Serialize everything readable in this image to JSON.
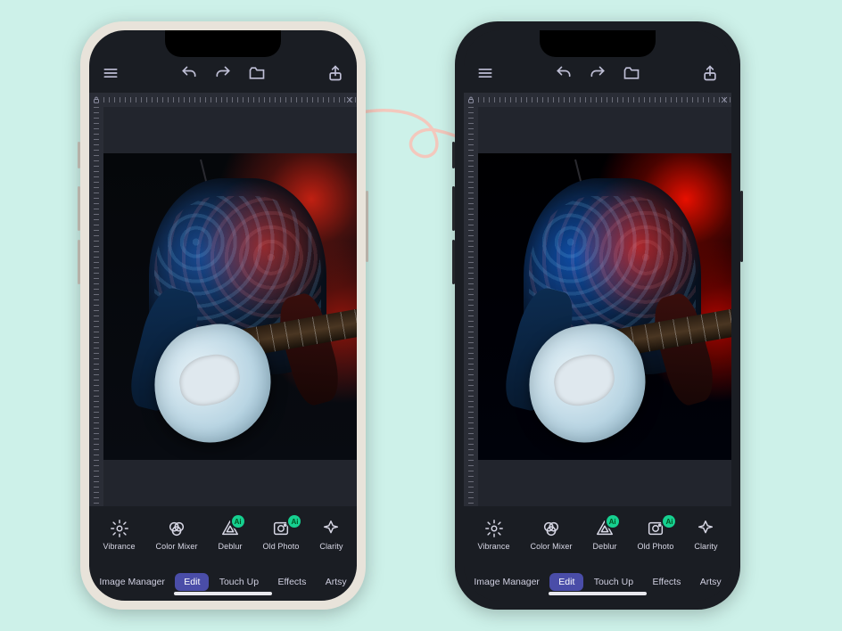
{
  "topbar": {
    "menu": "menu",
    "undo": "undo",
    "redo": "redo",
    "folder": "folder",
    "share": "share"
  },
  "ruler": {
    "lock": "lock",
    "close": "close"
  },
  "tools": [
    {
      "key": "vibrance",
      "label": "Vibrance",
      "ai": false
    },
    {
      "key": "colormixer",
      "label": "Color Mixer",
      "ai": false
    },
    {
      "key": "deblur",
      "label": "Deblur",
      "ai": true
    },
    {
      "key": "oldphoto",
      "label": "Old Photo",
      "ai": true
    },
    {
      "key": "clarity",
      "label": "Clarity",
      "ai": false
    }
  ],
  "ai_badge": "Ai",
  "tabs": {
    "image_manager": "Image Manager",
    "edit": "Edit",
    "touch_up": "Touch Up",
    "effects": "Effects",
    "artsy": "Artsy",
    "active": "edit"
  },
  "phones": {
    "left": {
      "variant": "before"
    },
    "right": {
      "variant": "after"
    }
  }
}
